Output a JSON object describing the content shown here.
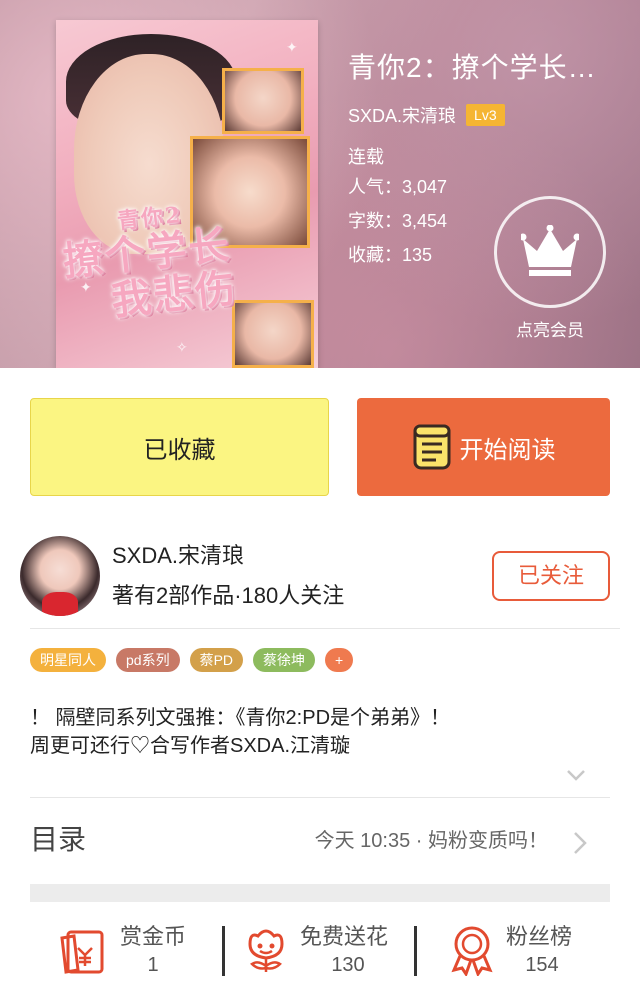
{
  "book": {
    "title": "青你2：撩个学长…",
    "author": "SXDA.宋清琅",
    "level": "Lv3",
    "status": "连载",
    "popularity_label": "人气：",
    "popularity": "3,047",
    "words_label": "字数：",
    "words": "3,454",
    "favorites_label": "收藏：",
    "favorites": "135"
  },
  "cover": {
    "art_line1": "青你2",
    "art_line2": "撩个学长",
    "art_line3": "我悲伤"
  },
  "vip": {
    "label": "点亮会员",
    "icon": "crown-icon"
  },
  "actions": {
    "favorite_label": "已收藏",
    "read_label": "开始阅读",
    "read_icon": "book-icon"
  },
  "author_card": {
    "name": "SXDA.宋清琅",
    "meta": "著有2部作品·180人关注",
    "follow_label": "已关注"
  },
  "tags": [
    {
      "label": "明星同人",
      "color": "#f4b13d"
    },
    {
      "label": "pd系列",
      "color": "#c87966"
    },
    {
      "label": "蔡PD",
      "color": "#d3a04a"
    },
    {
      "label": "蔡徐坤",
      "color": "#8dbb5e"
    },
    {
      "label": "+",
      "color": "#ef7a4f"
    }
  ],
  "description": {
    "line1": "！ 隔壁同系列文强推：《青你2:PD是个弟弟》！",
    "line2": "周更可还行♡合写作者SXDA.江清璇"
  },
  "catalog": {
    "label": "目录",
    "latest": "今天 10:35 · 妈粉变质吗！"
  },
  "bottom_stats": [
    {
      "label": "赏金币",
      "value": "1",
      "icon": "red-envelope-icon"
    },
    {
      "label": "免费送花",
      "value": "130",
      "icon": "flower-icon"
    },
    {
      "label": "粉丝榜",
      "value": "154",
      "icon": "ribbon-badge-icon"
    }
  ],
  "colors": {
    "accent": "#ec6a3e",
    "favorite_bg": "#fbf582",
    "level_badge": "#f5b533",
    "icon_red": "#e24a2f"
  }
}
